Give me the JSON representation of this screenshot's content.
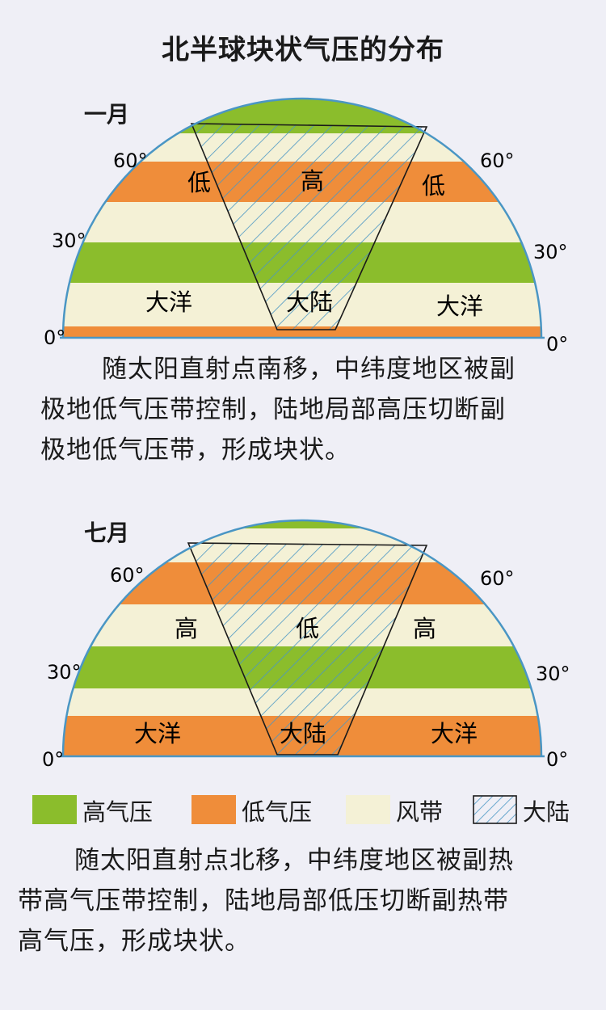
{
  "title": "北半球块状气压的分布",
  "colors": {
    "high": "#8bbd2c",
    "low": "#ef8d3a",
    "wind": "#f4f1d6",
    "outline": "#4a96c4",
    "hatch": "#4a96c4",
    "text": "#1a1a1a"
  },
  "january": {
    "month_label": "一月",
    "lat_60": "60°",
    "lat_30": "30°",
    "lat_0": "0°",
    "left_high_label": "低",
    "center_high_label": "高",
    "right_high_label": "低",
    "ocean_left": "大洋",
    "continent": "大陆",
    "ocean_right": "大洋",
    "paragraph": [
      "随太阳直射点南移，中纬度地区被副",
      "极地低气压带控制，陆地局部高压切断副",
      "极地低气压带，形成块状。"
    ]
  },
  "july": {
    "month_label": "七月",
    "lat_60": "60°",
    "lat_30": "30°",
    "lat_0": "0°",
    "left_high_label": "高",
    "center_high_label": "低",
    "right_high_label": "高",
    "ocean_left": "大洋",
    "continent": "大陆",
    "ocean_right": "大洋",
    "paragraph": [
      "随太阳直射点北移，中纬度地区被副热",
      "带高气压带控制，陆地局部低压切断副热带",
      "高气压，形成块状。"
    ]
  },
  "legend": {
    "high": "高气压",
    "low": "低气压",
    "wind": "风带",
    "continent": "大陆"
  }
}
